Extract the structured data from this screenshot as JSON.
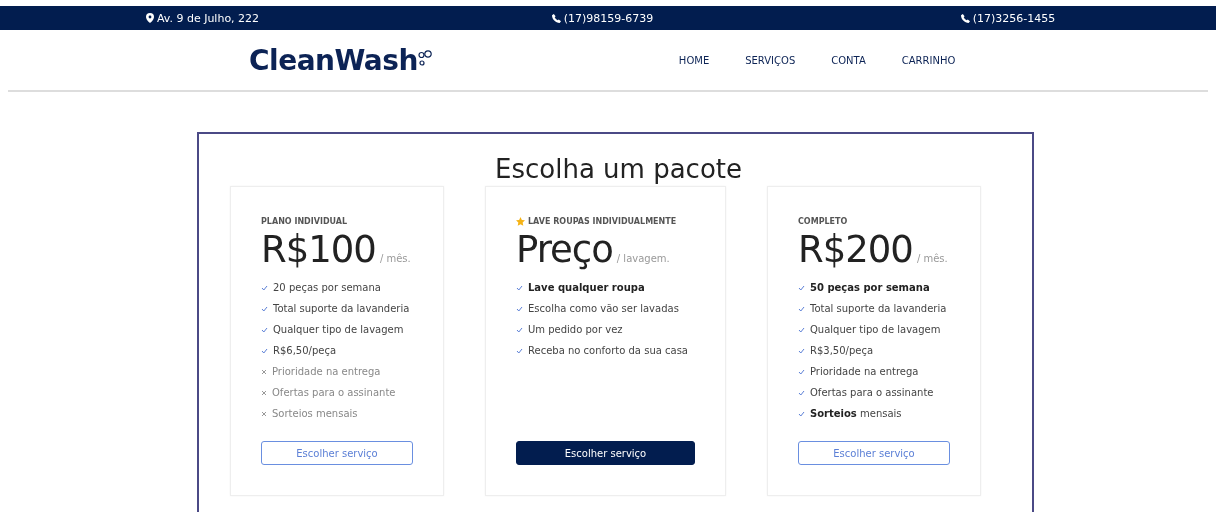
{
  "top_bar": {
    "address": "Av. 9 de Julho, 222",
    "phone_1": "(17)98159-6739",
    "phone_2": "(17)3256-1455"
  },
  "header": {
    "logo": "CleanWash",
    "nav": [
      {
        "label": "HOME"
      },
      {
        "label": "SERVIÇOS"
      },
      {
        "label": "CONTA"
      },
      {
        "label": "CARRINHO"
      }
    ]
  },
  "pricing": {
    "title": "Escolha um pacote",
    "plans": [
      {
        "label": "PLANO INDIVIDUAL",
        "featured": false,
        "price": "R$100",
        "period": "/ mês.",
        "features": [
          {
            "text": "20 peças por semana",
            "included": true
          },
          {
            "text": "Total suporte da lavanderia",
            "included": true
          },
          {
            "text": "Qualquer tipo de lavagem",
            "included": true
          },
          {
            "text": "R$6,50/peça",
            "included": true
          },
          {
            "text": "Prioridade na entrega",
            "included": false
          },
          {
            "text": "Ofertas para o assinante",
            "included": false
          },
          {
            "text": "Sorteios mensais",
            "included": false
          }
        ],
        "button": {
          "label": "Escolher serviço",
          "kind": "outline"
        }
      },
      {
        "label": "LAVE ROUPAS INDIVIDUALMENTE",
        "featured": true,
        "price": "Preço",
        "period": "/ lavagem.",
        "features": [
          {
            "text": "**Lave qualquer roupa**",
            "included": true
          },
          {
            "text": "Escolha como vão ser lavadas",
            "included": true
          },
          {
            "text": "Um pedido por vez",
            "included": true
          },
          {
            "text": "Receba no conforto da sua casa",
            "included": true
          }
        ],
        "button": {
          "label": "Escolher serviço",
          "kind": "primary"
        }
      },
      {
        "label": "COMPLETO",
        "featured": false,
        "price": "R$200",
        "period": "/ mês.",
        "features": [
          {
            "text": "**50 peças por semana**",
            "included": true
          },
          {
            "text": "Total suporte da lavanderia",
            "included": true
          },
          {
            "text": "Qualquer tipo de lavagem",
            "included": true
          },
          {
            "text": "R$3,50/peça",
            "included": true
          },
          {
            "text": "Prioridade na entrega",
            "included": true
          },
          {
            "text": "Ofertas para o assinante",
            "included": true
          },
          {
            "text": "**Sorteios** mensais",
            "included": true
          }
        ],
        "button": {
          "label": "Escolher serviço",
          "kind": "outline"
        }
      }
    ]
  }
}
